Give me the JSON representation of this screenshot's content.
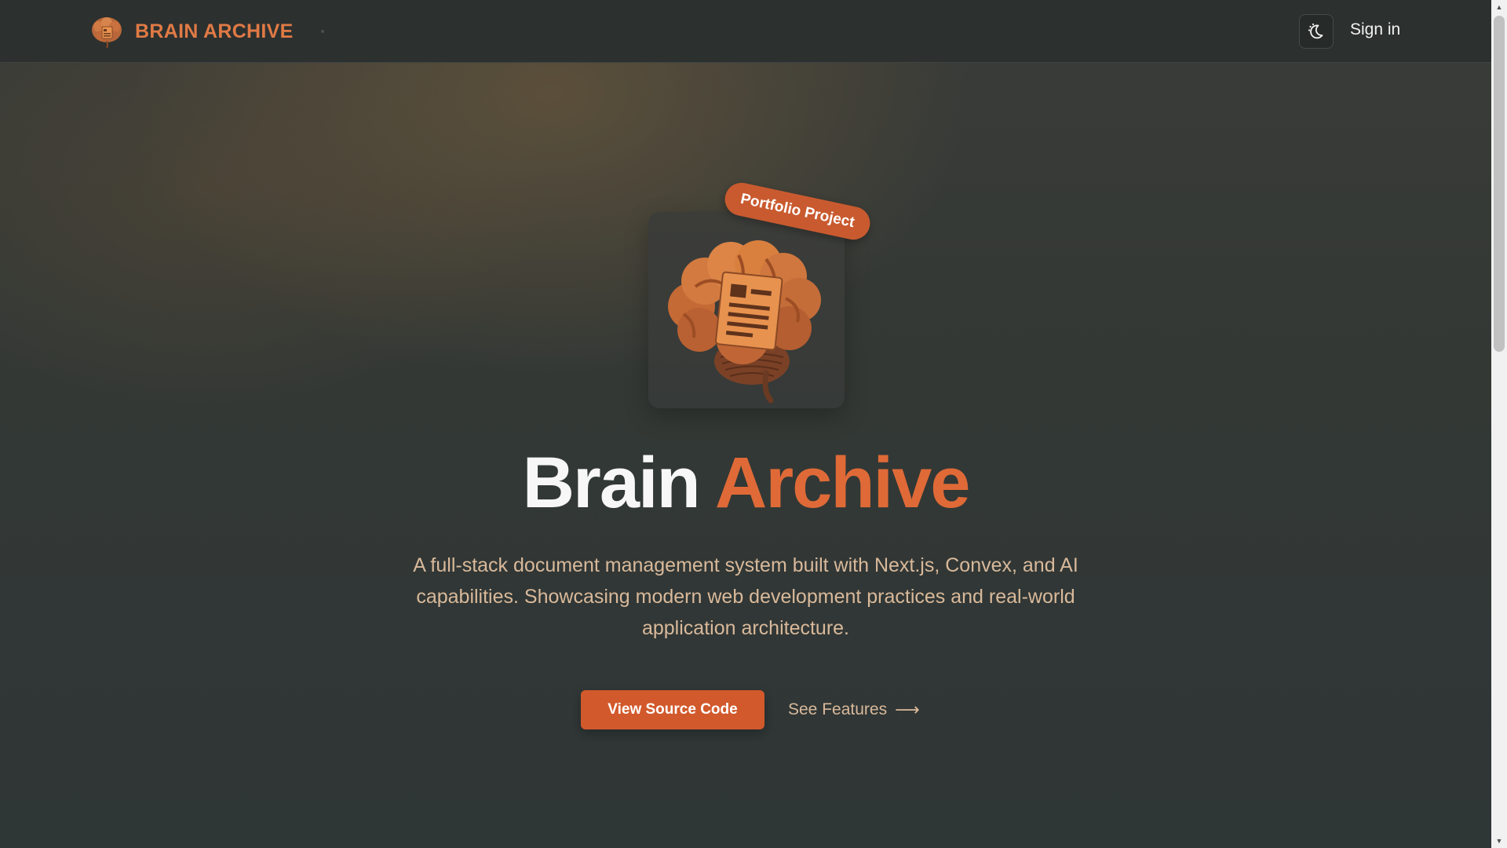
{
  "header": {
    "brand_name": "BRAIN ARCHIVE",
    "logo_icon": "brain-document-icon",
    "theme_toggle_icon": "moon-icon",
    "sign_in_label": "Sign in"
  },
  "hero": {
    "badge": "Portfolio Project",
    "title_part1": "Brain",
    "title_part2": "Archive",
    "subtitle": "A full-stack document management system built with Next.js, Convex, and AI capabilities. Showcasing modern web development practices and real-world application architecture.",
    "primary_button": "View Source Code",
    "secondary_link": "See Features",
    "secondary_arrow": "⟶"
  },
  "colors": {
    "accent": "#d2592b",
    "accent_text": "#df6a37",
    "subtitle_text": "#d9b99a",
    "background": "#2f3636"
  },
  "scrollbar": {
    "up_arrow": "▲",
    "down_arrow": "▼"
  }
}
